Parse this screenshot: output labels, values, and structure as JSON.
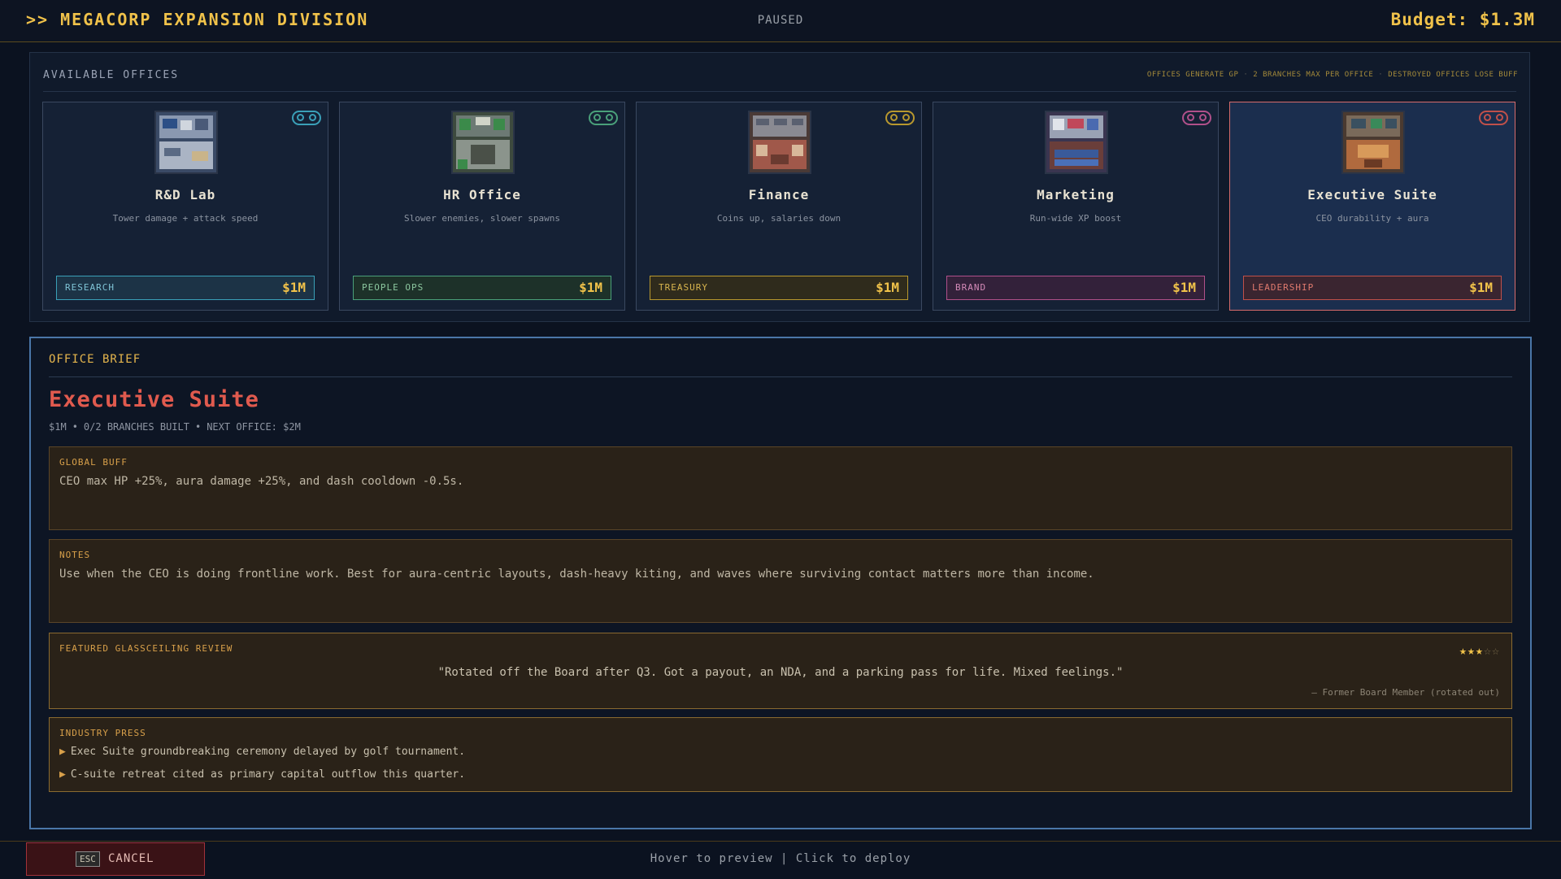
{
  "header": {
    "title": ">> MEGACORP EXPANSION DIVISION",
    "status": "PAUSED",
    "budget": "Budget: $1.3M"
  },
  "offices_panel": {
    "heading": "AVAILABLE OFFICES",
    "info": [
      "OFFICES GENERATE GP",
      "2 BRANCHES MAX PER OFFICE",
      "DESTROYED OFFICES LOSE BUFF"
    ],
    "cards": [
      {
        "name": "R&D Lab",
        "desc": "Tower damage + attack speed",
        "category": "RESEARCH",
        "price": "$1M",
        "accent": "#3aa0b8",
        "cat_bg": "#1c3346",
        "cat_color": "#7fc4d6",
        "icon": "lab-office-icon"
      },
      {
        "name": "HR Office",
        "desc": "Slower enemies, slower spawns",
        "category": "PEOPLE OPS",
        "price": "$1M",
        "accent": "#4aa07a",
        "cat_bg": "#1d3129",
        "cat_color": "#8cc79f",
        "icon": "hr-office-icon"
      },
      {
        "name": "Finance",
        "desc": "Coins up, salaries down",
        "category": "TREASURY",
        "price": "$1M",
        "accent": "#b8982e",
        "cat_bg": "#2f2b1c",
        "cat_color": "#d8b54e",
        "icon": "finance-office-icon"
      },
      {
        "name": "Marketing",
        "desc": "Run-wide XP boost",
        "category": "BRAND",
        "price": "$1M",
        "accent": "#b0508a",
        "cat_bg": "#33213a",
        "cat_color": "#d48ab8",
        "icon": "marketing-office-icon"
      },
      {
        "name": "Executive Suite",
        "desc": "CEO durability + aura",
        "category": "LEADERSHIP",
        "price": "$1M",
        "accent": "#c0504a",
        "cat_bg": "#3a2530",
        "cat_color": "#e07a6e",
        "icon": "executive-office-icon",
        "selected": true
      }
    ]
  },
  "brief": {
    "label": "OFFICE BRIEF",
    "title": "Executive Suite",
    "meta": [
      "$1M",
      "0/2 BRANCHES BUILT",
      "NEXT OFFICE: $2M"
    ],
    "global_buff": {
      "label": "GLOBAL BUFF",
      "text": "CEO max HP +25%, aura damage +25%, and dash cooldown -0.5s."
    },
    "notes": {
      "label": "NOTES",
      "text": "Use when the CEO is doing frontline work. Best for aura-centric layouts, dash-heavy kiting, and waves where surviving contact matters more than income."
    },
    "review": {
      "label": "FEATURED GLASSCEILING REVIEW",
      "rating": 3,
      "rating_max": 5,
      "stars_on": "★★★",
      "stars_off": "☆☆",
      "quote": "\"Rotated off the Board after Q3. Got a payout, an NDA, and a parking pass for life. Mixed feelings.\"",
      "attribution": "— Former Board Member (rotated out)"
    },
    "press": {
      "label": "INDUSTRY PRESS",
      "items": [
        "Exec Suite groundbreaking ceremony delayed by golf tournament.",
        "C-suite retreat cited as primary capital outflow this quarter."
      ]
    }
  },
  "footer": {
    "cancel_key": "ESC",
    "cancel_label": "CANCEL",
    "hint": "Hover to preview  |  Click to deploy"
  }
}
